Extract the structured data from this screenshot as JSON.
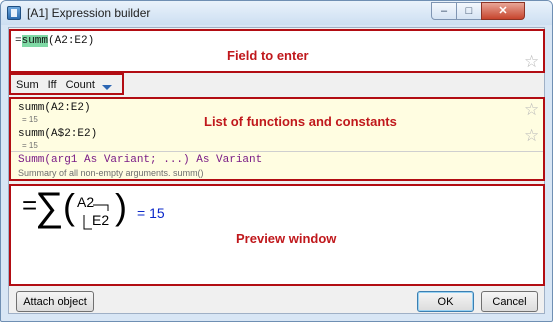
{
  "window": {
    "title": "[A1] Expression builder",
    "minimize": "–",
    "maximize": "□",
    "close": "✕"
  },
  "formula": {
    "prefix": "=",
    "highlighted": "summ",
    "rest": "(A2:E2)"
  },
  "tabs": [
    "Sum",
    "Iff",
    "Count"
  ],
  "functions": [
    {
      "name": "summ(A2:E2)",
      "value": "= 15"
    },
    {
      "name": "summ(A$2:E2)",
      "value": "= 15"
    }
  ],
  "signature": "Summ(arg1 As Variant; ...) As Variant",
  "description": "Summary of all non-empty arguments. summ()",
  "preview": {
    "eq": "=",
    "sigma": "∑",
    "lparen": "(",
    "rparen": ")",
    "from": "A2",
    "to": "E2",
    "result": "= 15"
  },
  "annotations": {
    "field": "Field to enter",
    "list": "List of functions and constants",
    "preview": "Preview window"
  },
  "buttons": {
    "attach": "Attach object",
    "ok": "OK",
    "cancel": "Cancel"
  },
  "colors": {
    "annotation": "#c0181c",
    "list_background": "#fffde1",
    "signature": "#7a1c86",
    "result": "#0b28c9",
    "highlight": "#7fd9a5"
  }
}
